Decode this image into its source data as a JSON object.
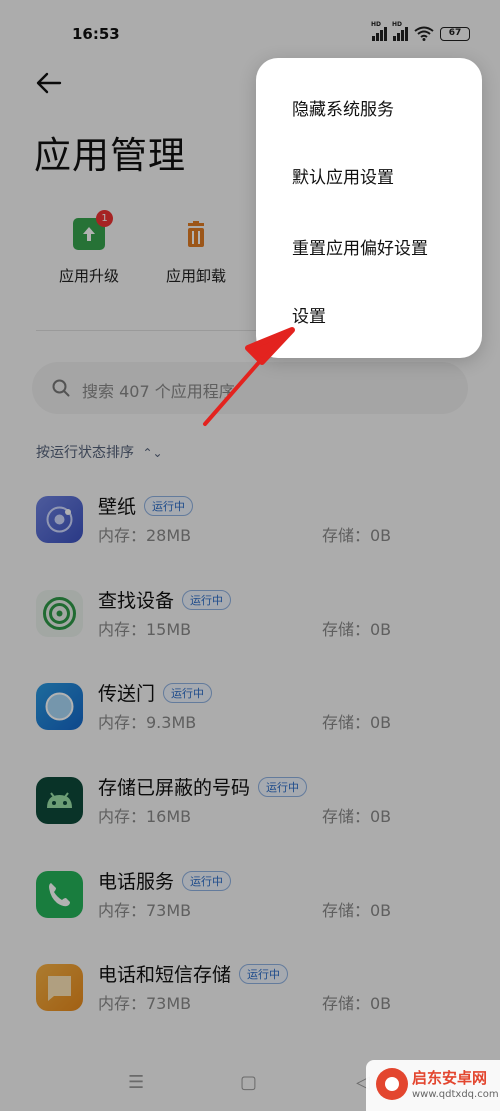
{
  "status_bar": {
    "time": "16:53",
    "battery": "67",
    "sim_labels": [
      "HD",
      "HD"
    ]
  },
  "page": {
    "title": "应用管理"
  },
  "quick_actions": [
    {
      "label": "应用升级",
      "badge": "1"
    },
    {
      "label": "应用卸载"
    }
  ],
  "search": {
    "placeholder": "搜索 407 个应用程序"
  },
  "sort": {
    "label": "按运行状态排序"
  },
  "apps": [
    {
      "name": "壁纸",
      "tag": "运行中",
      "memory": "内存：28MB",
      "storage": "存储：0B"
    },
    {
      "name": "查找设备",
      "tag": "运行中",
      "memory": "内存：15MB",
      "storage": "存储：0B"
    },
    {
      "name": "传送门",
      "tag": "运行中",
      "memory": "内存：9.3MB",
      "storage": "存储：0B"
    },
    {
      "name": "存储已屏蔽的号码",
      "tag": "运行中",
      "memory": "内存：16MB",
      "storage": "存储：0B"
    },
    {
      "name": "电话服务",
      "tag": "运行中",
      "memory": "内存：73MB",
      "storage": "存储：0B"
    },
    {
      "name": "电话和短信存储",
      "tag": "运行中",
      "memory": "内存：73MB",
      "storage": "存储：0B"
    }
  ],
  "menu": {
    "items": [
      "隐藏系统服务",
      "默认应用设置",
      "重置应用偏好设置",
      "设置"
    ]
  },
  "watermark": {
    "name": "启东安卓网",
    "url": "www.qdtxdq.com"
  },
  "colors": {
    "accent": "#2b6cc7",
    "arrow": "#e3231f",
    "badge": "#e33333"
  }
}
